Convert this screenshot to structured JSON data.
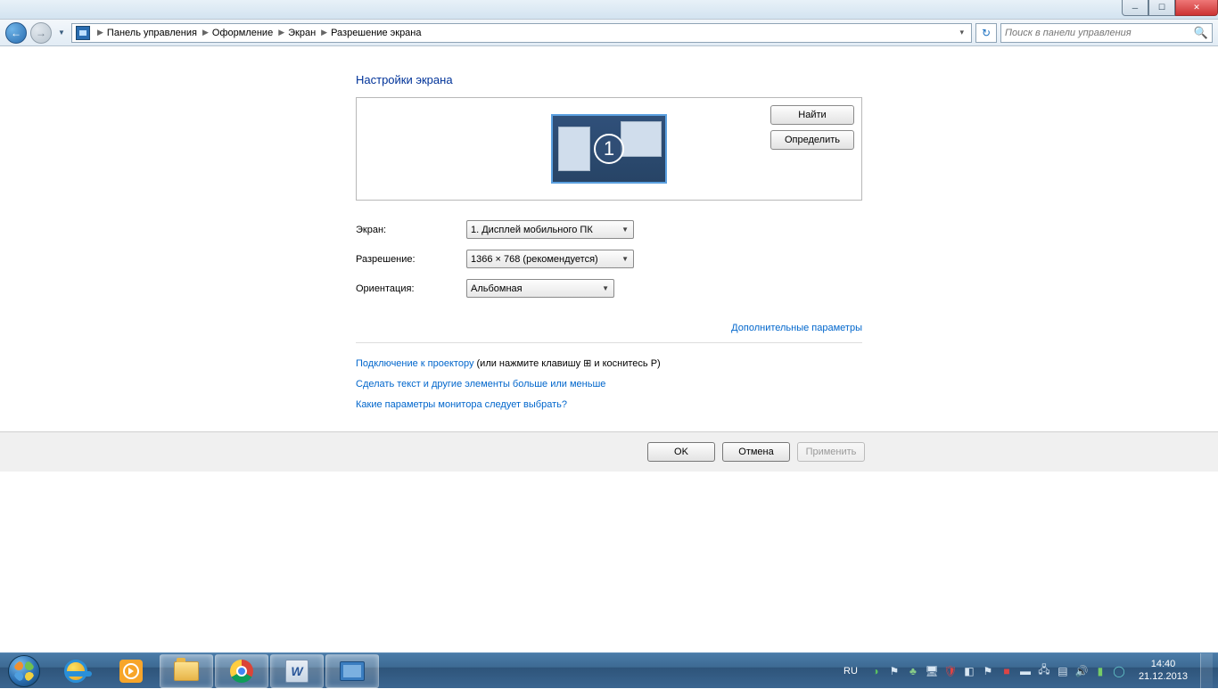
{
  "titlebar": {},
  "nav": {
    "breadcrumbs": [
      "Панель управления",
      "Оформление",
      "Экран",
      "Разрешение экрана"
    ],
    "search_placeholder": "Поиск в панели управления"
  },
  "page": {
    "title": "Настройки экрана",
    "monitor_number": "1",
    "find_btn": "Найти",
    "identify_btn": "Определить",
    "rows": {
      "screen_label": "Экран:",
      "screen_value": "1. Дисплей мобильного ПК",
      "resolution_label": "Разрешение:",
      "resolution_value": "1366 × 768 (рекомендуется)",
      "orientation_label": "Ориентация:",
      "orientation_value": "Альбомная"
    },
    "advanced_link": "Дополнительные параметры",
    "links": {
      "projector": "Подключение к проектору",
      "projector_suffix1": " (или нажмите клавишу ",
      "projector_suffix2": " и коснитесь P)",
      "text_size": "Сделать текст и другие элементы больше или меньше",
      "which_settings": "Какие параметры монитора следует выбрать?"
    },
    "buttons": {
      "ok": "OK",
      "cancel": "Отмена",
      "apply": "Применить"
    }
  },
  "taskbar": {
    "lang": "RU",
    "time": "14:40",
    "date": "21.12.2013"
  }
}
